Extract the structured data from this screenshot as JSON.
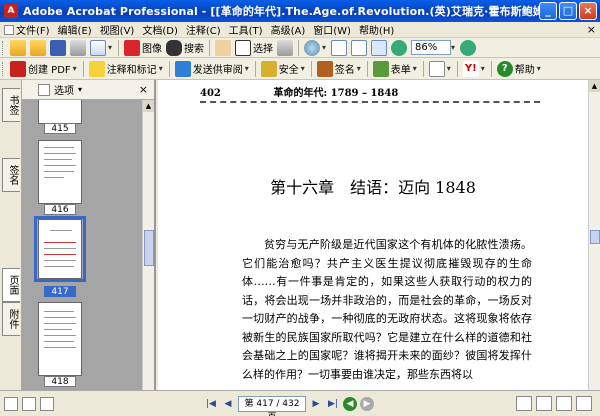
{
  "window": {
    "title": "Adobe Acrobat Professional - [[革命的年代].The.Age.of.Revolution.(英)艾瑞克·霍布斯鲍姆.扫描版.pdf]",
    "app_icon": "acrobat-icon",
    "controls": [
      "_",
      "□",
      "×"
    ]
  },
  "menu": {
    "items": [
      "文件(F)",
      "编辑(E)",
      "视图(V)",
      "文档(D)",
      "注释(C)",
      "工具(T)",
      "高级(A)",
      "窗口(W)",
      "帮助(H)"
    ],
    "close": "×"
  },
  "toolbar1": {
    "find_label": "搜索",
    "select_label": "选择",
    "zoom_value": "86%"
  },
  "toolbar2": {
    "create_pdf": "创建 PDF",
    "comment": "注释和标记",
    "review": "发送供审阅",
    "secure": "安全",
    "sign": "签名",
    "forms": "表单",
    "help": "帮助"
  },
  "sidetabs": [
    "书签",
    "签名",
    "页面",
    "附件"
  ],
  "panel": {
    "options_label": "选项",
    "close": "×",
    "thumbnails": [
      {
        "label": "415"
      },
      {
        "label": "416"
      },
      {
        "label": "417",
        "selected": true
      },
      {
        "label": "418"
      }
    ]
  },
  "document": {
    "page_number": "402",
    "running_title": "革命的年代: 1789 – 1848",
    "chapter_title": "第十六章　结语：迈向 1848",
    "body": "贫穷与无产阶级是近代国家这个有机体的化脓性溃疡。它们能治愈吗？共产主义医生提议彻底摧毁现存的生命体……有一件事是肯定的，如果这些人获取行动的权力的话，将会出现一场并非政治的，而是社会的革命，一场反对一切财产的战争，一种彻底的无政府状态。这将现象将依存被新生的民族国家所取代吗？它是建立在什么样的道德和社会基础之上的国家呢？谁将揭开未来的面纱？彼国将发挥什么样的作用？一切事要由谁决定，那些东西将以"
  },
  "status": {
    "page_field": "第 417 / 432 页"
  }
}
